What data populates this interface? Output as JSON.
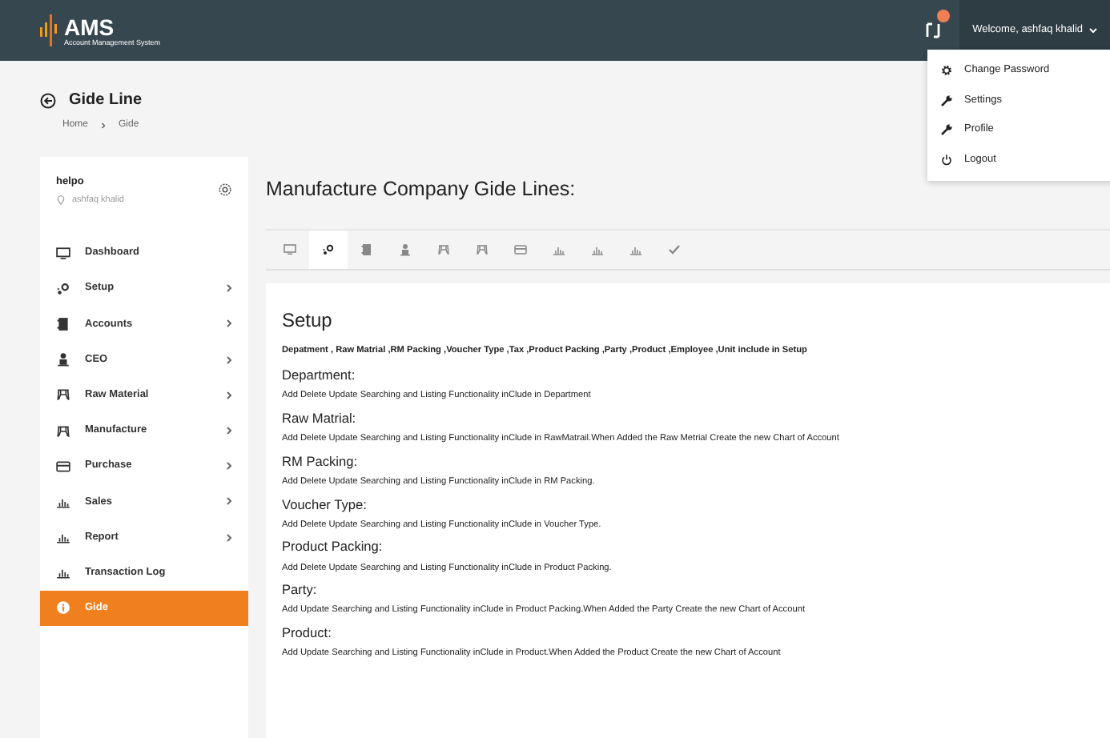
{
  "header": {
    "logo_title": "AMS",
    "logo_subtitle": "Account Management System",
    "notification_badge": true,
    "user_menu": "Welcome, ashfaq khalid"
  },
  "user_dropdown": [
    {
      "kind": "gear",
      "label": "Change Password"
    },
    {
      "kind": "wrench",
      "label": "Settings"
    },
    {
      "kind": "wrench",
      "label": "Profile"
    },
    {
      "kind": "power",
      "label": "Logout"
    }
  ],
  "page": {
    "title": "Gide Line",
    "breadcrumb": [
      "Home",
      "Gide"
    ]
  },
  "sidebar": {
    "company": "helpo",
    "user": "ashfaq khalid",
    "items": [
      {
        "kind": "monitor",
        "label": "Dashboard",
        "has_submenu": false,
        "selected": false
      },
      {
        "kind": "gears",
        "label": "Setup",
        "has_submenu": true,
        "selected": false
      },
      {
        "kind": "book",
        "label": "Accounts",
        "has_submenu": true,
        "selected": false
      },
      {
        "kind": "person",
        "label": "CEO",
        "has_submenu": true,
        "selected": false
      },
      {
        "kind": "machine",
        "label": "Raw Material",
        "has_submenu": true,
        "selected": false
      },
      {
        "kind": "machine",
        "label": "Manufacture",
        "has_submenu": true,
        "selected": false
      },
      {
        "kind": "card",
        "label": "Purchase",
        "has_submenu": true,
        "selected": false
      },
      {
        "kind": "chart",
        "label": "Sales",
        "has_submenu": true,
        "selected": false
      },
      {
        "kind": "chart",
        "label": "Report",
        "has_submenu": true,
        "selected": false
      },
      {
        "kind": "chart",
        "label": "Transaction Log",
        "has_submenu": false,
        "selected": false
      },
      {
        "kind": "info",
        "label": "Gide",
        "has_submenu": false,
        "selected": true
      }
    ]
  },
  "main": {
    "heading": "Manufacture Company Gide Lines:",
    "tabs": [
      {
        "kind": "monitor",
        "selected": false
      },
      {
        "kind": "gears",
        "selected": true
      },
      {
        "kind": "book",
        "selected": false
      },
      {
        "kind": "person",
        "selected": false
      },
      {
        "kind": "machine",
        "selected": false
      },
      {
        "kind": "machine",
        "selected": false
      },
      {
        "kind": "card",
        "selected": false
      },
      {
        "kind": "chart",
        "selected": false
      },
      {
        "kind": "chart",
        "selected": false
      },
      {
        "kind": "chart",
        "selected": false
      },
      {
        "kind": "check",
        "selected": false
      }
    ],
    "section_title": "Setup",
    "summary": "Depatment , Raw Matrial ,RM Packing ,Voucher Type ,Tax ,Product Packing ,Party ,Product ,Employee ,Unit include in Setup",
    "entries": [
      {
        "title": "Department:",
        "text": "Add Delete Update Searching and Listing Functionality inClude in Department"
      },
      {
        "title": "Raw Matrial:",
        "text": "Add Delete Update Searching and Listing Functionality inClude in RawMatrail.When Added the Raw Metrial Create the new Chart of Account"
      },
      {
        "title": "RM Packing:",
        "text": "Add Delete Update Searching and Listing Functionality inClude in RM Packing."
      },
      {
        "title": "Voucher Type:",
        "text": "Add Delete Update Searching and Listing Functionality inClude in Voucher Type."
      },
      {
        "title": "Product Packing:",
        "text": "Add Delete Update Searching and Listing Functionality inClude in Product Packing."
      },
      {
        "title": "Party:",
        "text": "Add Update Searching and Listing Functionality inClude in Product Packing.When Added the Party Create the new Chart of Account"
      },
      {
        "title": "Product:",
        "text": "Add Update Searching and Listing Functionality inClude in Product.When Added the Product Create the new Chart of Account"
      }
    ]
  }
}
